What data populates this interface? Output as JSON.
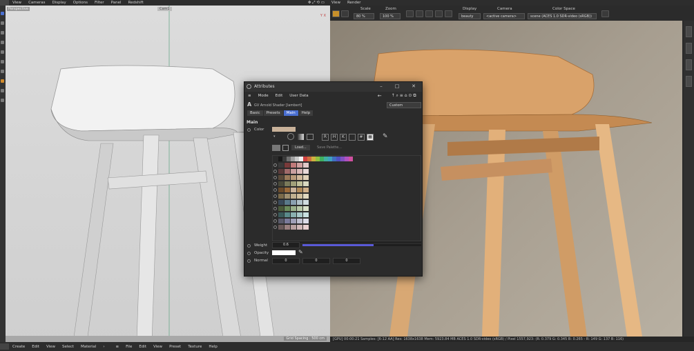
{
  "menubar": {
    "left_items": [
      "View",
      "Cameras",
      "Display",
      "Options",
      "Filter",
      "Panel",
      "Redshift"
    ],
    "right_items": [
      "View",
      "Render"
    ]
  },
  "viewport": {
    "label": "Perspective",
    "camera": "Cam1",
    "grid_spacing": "Grid Spacing : 500 cm",
    "axes": "Y X"
  },
  "render_toolbar": {
    "scale_label": "Scale",
    "scale_value": "80 %",
    "zoom_label": "Zoom",
    "zoom_value": "100 %",
    "display_label": "Display",
    "display_value": "beauty",
    "camera_label": "Camera",
    "camera_value": "<active camera>",
    "colorspace_label": "Color Space",
    "colorspace_value": "scene (ACES 1.0 SDR-video (sRGB))"
  },
  "render_status": "[GPU] 00:00:21  Samples: [6-12 AA]  Res: 1638x1638  Mem: 5923.84 MB  ACES 1.0 SDR-video (sRGB) / Pixel 1557,923: (R: 0.379 G: 0.345 B: 0.265 - R: 149 G: 137 B: 116)",
  "bottombar": {
    "left_items": [
      "Create",
      "Edit",
      "View",
      "Select",
      "Material"
    ],
    "right_items": [
      "File",
      "Edit",
      "View",
      "Preset",
      "Texture",
      "Help"
    ]
  },
  "attributes": {
    "title": "Attributes",
    "menu": [
      "Mode",
      "Edit",
      "User Data"
    ],
    "preset_select": "Custom",
    "shader_name": "GV Arnold Shader [lambert]",
    "tabs": [
      {
        "label": "Basic",
        "active": false
      },
      {
        "label": "Presets",
        "active": false
      },
      {
        "label": "Main",
        "active": true
      },
      {
        "label": "Help",
        "active": false
      }
    ],
    "section": "Main",
    "color_label": "Color",
    "color_value": "#c9b29a",
    "mode_keys": [
      "R",
      "H",
      "K",
      "",
      "#"
    ],
    "load_label": "Load...",
    "save_palette_label": "Save Palette...",
    "palette_top": [
      "#1a1a1a",
      "#3a3a3a",
      "#707070",
      "#a0a0a0",
      "#c8c8c8",
      "#f0f0f0",
      "#d04040",
      "#d07040",
      "#d0b040",
      "#90c040",
      "#40b060",
      "#40b0a0",
      "#40a0c0",
      "#4070c0",
      "#5050c0",
      "#8050c0",
      "#b050c0",
      "#d050a0"
    ],
    "palette_rows": [
      [
        "#3a3a3a",
        "#7a3a3a",
        "#c07a7a",
        "#d0a0a0",
        "#e0c8c8"
      ],
      [
        "#5a3a3a",
        "#a06a6a",
        "#c9a0a0",
        "#d9b8b8",
        "#e8d8d8"
      ],
      [
        "#5a4a3a",
        "#9a7a5a",
        "#b89a7a",
        "#d0b89a",
        "#e0d0b8"
      ],
      [
        "#4a4a3a",
        "#7a7a5a",
        "#a0a07a",
        "#c0c09a",
        "#d8d8c0"
      ],
      [
        "#6a4a2a",
        "#9a6a3a",
        "#c9b29a",
        "#b08a5a",
        "#d0b08a"
      ],
      [
        "#7a6a4a",
        "#a09070",
        "#c0b090",
        "#d0c0a0",
        "#e0d8c0"
      ],
      [
        "#3a4a5a",
        "#5a7a8a",
        "#8aa0b0",
        "#b0c0c8",
        "#d0dce0"
      ],
      [
        "#4a5a3a",
        "#6a8a5a",
        "#9ab08a",
        "#b8c8a8",
        "#d8e0c8"
      ],
      [
        "#3a5a5a",
        "#5a8a8a",
        "#8ab0b0",
        "#a8c8c8",
        "#c8e0e0"
      ],
      [
        "#5a5a6a",
        "#7a7a9a",
        "#a0a0b8",
        "#c0c0d0",
        "#dcdce8"
      ],
      [
        "#6a5a5a",
        "#9a8080",
        "#b8a0a0",
        "#d0b8b8",
        "#e8d0d0"
      ]
    ],
    "weight_label": "Weight",
    "weight_value": "0.6",
    "weight_fraction": 0.6,
    "opacity_label": "Opacity",
    "opacity_value": "#ffffff",
    "normal_label": "Normal",
    "normal_values": [
      "0",
      "0",
      "0"
    ]
  }
}
